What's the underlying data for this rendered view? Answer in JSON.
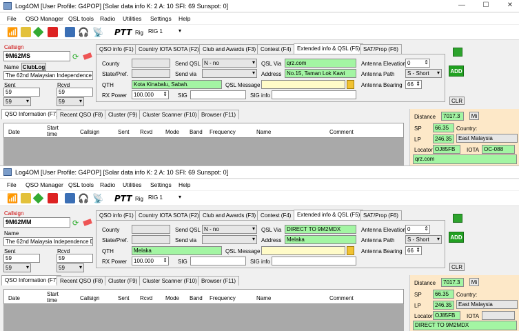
{
  "windows": [
    {
      "title": "Log4OM [User Profile: G4POP] [Solar data info K: 2 A: 10 SFI: 69 Sunspot: 0]",
      "menu": [
        "File",
        "QSO Manager",
        "QSL tools",
        "Radio",
        "Utilities",
        "Settings",
        "Help"
      ],
      "ptt": "PTT",
      "rig_label": "Rig",
      "rig_value": "RIG 1",
      "callsign_label": "Callsign",
      "callsign": "9M62MS",
      "name_label": "Name",
      "club_log": "ClubLog",
      "name_value": "The 62nd Malaysian Independence",
      "sent_label": "Sent",
      "rcvd_label": "Rcvd",
      "sent": "59",
      "rcvd": "59",
      "sent_sel": "59",
      "rcvd_sel": "59",
      "tabs": [
        "QSO info (F1)",
        "Country IOTA SOTA (F2)",
        "Club and Awards (F3)",
        "Contest (F4)",
        "Extended info & QSL (F5)",
        "SAT/Prop (F6)"
      ],
      "county_label": "County",
      "state_label": "State/Pref.",
      "qth_label": "QTH",
      "rxpower_label": "RX Power",
      "qth": "Kota Kinabalu, Sabah.",
      "rxpower": "100.000",
      "sig_label": "SIG",
      "siginfo_label": "SIG info",
      "sendqsl_label": "Send QSL",
      "sendvia_label": "Send via",
      "sendqsl_value": "N - no",
      "qslmsg_label": "QSL Message",
      "qslvia_label": "QSL Via",
      "qslvia": "qrz.com",
      "address_label": "Address",
      "address": "No.15, Taman Lok Kawi",
      "ant_elev_label": "Antenna Elevation",
      "ant_elev": "0",
      "ant_path_label": "Antenna Path",
      "ant_path": "S - Short",
      "ant_bear_label": "Antenna Bearing",
      "ant_bear": "66",
      "add": "ADD",
      "clr": "CLR",
      "lower_tabs": [
        "QSO Information (F7)",
        "Recent QSO (F8)",
        "Cluster (F9)",
        "Cluster Scanner (F10)",
        "Browser (F11)"
      ],
      "columns": [
        "Date",
        "Start time",
        "Callsign",
        "Sent",
        "Rcvd",
        "Mode",
        "Band",
        "Frequency",
        "Name",
        "Comment"
      ],
      "distance_label": "Distance",
      "distance": "7017.3",
      "mi": "Mi",
      "sp_label": "SP",
      "sp": "66.35",
      "lp_label": "LP",
      "lp": "246.35",
      "country_label": "Country:",
      "country": "East Malaysia",
      "locator_label": "Locator",
      "locator": "OJ85FB",
      "iota_label": "IOTA",
      "iota": "OC-088",
      "qsl_info": "qrz.com"
    },
    {
      "title": "Log4OM [User Profile: G4POP] [Solar data info K: 2 A: 10 SFI: 69 Sunspot: 0]",
      "menu": [
        "File",
        "QSO Manager",
        "QSL tools",
        "Radio",
        "Utilities",
        "Settings",
        "Help"
      ],
      "ptt": "PTT",
      "rig_label": "Rig",
      "rig_value": "RIG 1",
      "callsign_label": "Callsign",
      "callsign": "9M62MM",
      "name_label": "Name",
      "name_value": "The 62nd Malaysia Independence Day",
      "sent_label": "Sent",
      "rcvd_label": "Rcvd",
      "sent": "59",
      "rcvd": "59",
      "sent_sel": "59",
      "rcvd_sel": "59",
      "tabs": [
        "QSO info (F1)",
        "Country IOTA SOTA (F2)",
        "Club and Awards (F3)",
        "Contest (F4)",
        "Extended info & QSL (F5)",
        "SAT/Prop (F6)"
      ],
      "county_label": "County",
      "state_label": "State/Pref.",
      "qth_label": "QTH",
      "rxpower_label": "RX Power",
      "qth": "Melaka",
      "rxpower": "100.000",
      "sig_label": "SIG",
      "siginfo_label": "SIG info",
      "sendqsl_label": "Send QSL",
      "sendvia_label": "Send via",
      "sendqsl_value": "N - no",
      "qslmsg_label": "QSL Message",
      "qslvia_label": "QSL Via",
      "qslvia": "DIRECT TO 9M2MDX",
      "address_label": "Address",
      "address": "Melaka",
      "ant_elev_label": "Antenna Elevation",
      "ant_elev": "0",
      "ant_path_label": "Antenna Path",
      "ant_path": "S - Short",
      "ant_bear_label": "Antenna Bearing",
      "ant_bear": "66",
      "add": "ADD",
      "clr": "CLR",
      "lower_tabs": [
        "QSO Information (F7)",
        "Recent QSO (F8)",
        "Cluster (F9)",
        "Cluster Scanner (F10)",
        "Browser (F11)"
      ],
      "columns": [
        "Date",
        "Start time",
        "Callsign",
        "Sent",
        "Rcvd",
        "Mode",
        "Band",
        "Frequency",
        "Name",
        "Comment"
      ],
      "distance_label": "Distance",
      "distance": "7017.3",
      "mi": "Mi",
      "sp_label": "SP",
      "sp": "66.35",
      "lp_label": "LP",
      "lp": "246.35",
      "country_label": "Country:",
      "country": "East Malaysia",
      "locator_label": "Locator",
      "locator": "OJ85FB",
      "iota_label": "IOTA",
      "iota": "",
      "qsl_info": "DIRECT TO 9M2MDX"
    }
  ]
}
